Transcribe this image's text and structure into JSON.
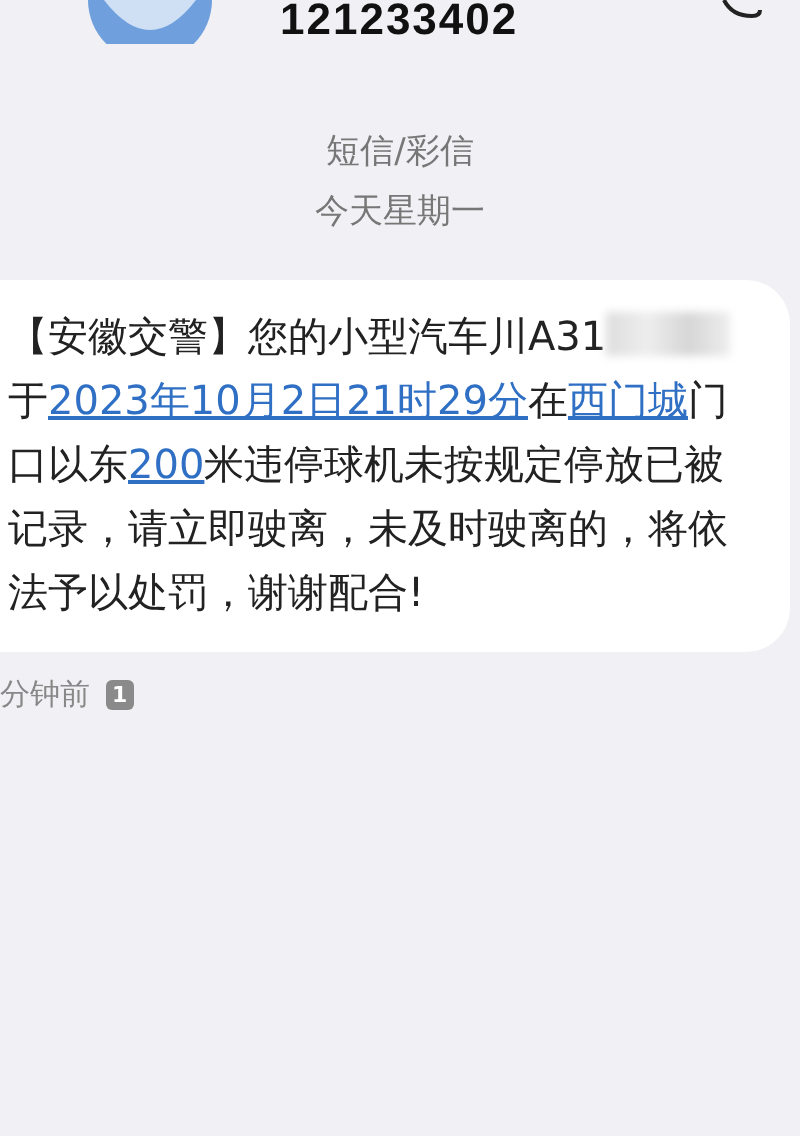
{
  "header": {
    "phone_number": "121233402"
  },
  "channel_label": "短信/彩信",
  "date_label": "今天星期一",
  "message": {
    "segments": [
      {
        "kind": "plain",
        "text": "【安徽交警】您的小型汽车川A31"
      },
      {
        "kind": "redacted"
      },
      {
        "kind": "plain",
        "text": "于"
      },
      {
        "kind": "link",
        "text": "2023年10月2日21时29分"
      },
      {
        "kind": "plain",
        "text": "在"
      },
      {
        "kind": "link",
        "text": "西门城"
      },
      {
        "kind": "plain",
        "text": "门口以东"
      },
      {
        "kind": "link",
        "text": "200"
      },
      {
        "kind": "plain",
        "text": "米违停球机未按规定停放已被记录，请立即驶离，未及时驶离的，将依法予以处罚，谢谢配合!"
      }
    ]
  },
  "footer": {
    "time": "分钟前",
    "sim": "1"
  }
}
